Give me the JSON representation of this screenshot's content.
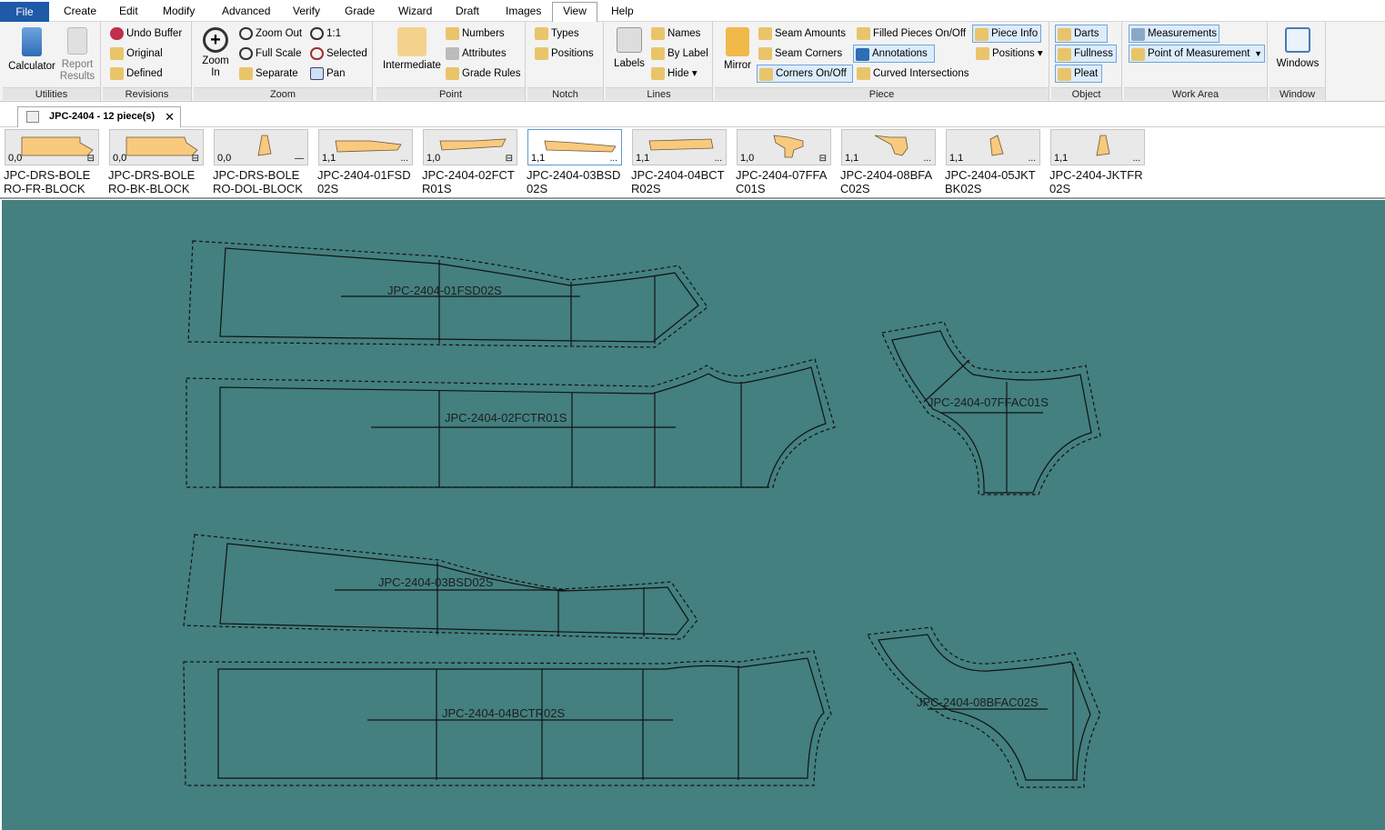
{
  "menu": {
    "file": "File",
    "items": [
      "Create",
      "Edit",
      "Modify",
      "Advanced",
      "Verify",
      "Grade",
      "Wizard",
      "Draft",
      "Images",
      "View",
      "Help"
    ]
  },
  "ribbon": {
    "utilities": {
      "label": "Utilities",
      "calculator": "Calculator",
      "report_results_line1": "Report",
      "report_results_line2": "Results"
    },
    "revisions": {
      "label": "Revisions",
      "undo_buffer": "Undo Buffer",
      "original": "Original",
      "defined": "Defined"
    },
    "zoom": {
      "label": "Zoom",
      "zoom_in_line1": "Zoom",
      "zoom_in_line2": "In",
      "zoom_out": "Zoom Out",
      "full_scale": "Full Scale",
      "separate": "Separate",
      "one_to_one": "1:1",
      "selected": "Selected",
      "pan": "Pan"
    },
    "point": {
      "label": "Point",
      "intermediate": "Intermediate",
      "numbers": "Numbers",
      "attributes": "Attributes",
      "grade_rules": "Grade Rules"
    },
    "notch": {
      "label": "Notch",
      "types": "Types",
      "positions": "Positions"
    },
    "lines": {
      "label": "Lines",
      "labels": "Labels",
      "names": "Names",
      "by_label": "By Label",
      "hide": "Hide ▾"
    },
    "piece": {
      "label": "Piece",
      "mirror": "Mirror",
      "seam_amounts": "Seam Amounts",
      "seam_corners": "Seam Corners",
      "corners_on_off": "Corners On/Off",
      "filled_pieces": "Filled Pieces On/Off",
      "annotations": "Annotations",
      "curved_intersections": "Curved Intersections",
      "piece_info": "Piece Info",
      "positions": "Positions ▾"
    },
    "object": {
      "label": "Object",
      "darts": "Darts",
      "fullness": "Fullness",
      "pleat": "Pleat"
    },
    "work_area": {
      "label": "Work Area",
      "measurements": "Measurements",
      "point_of_measurement": "Point of Measurement"
    },
    "window": {
      "label": "Window",
      "windows": "Windows"
    }
  },
  "doc_tab": {
    "title": "JPC-2404  -  12 piece(s)",
    "close": "✕"
  },
  "pieces": [
    {
      "line1": "JPC-DRS-BOLE",
      "line2": "RO-FR-BLOCK",
      "code": "0,0",
      "icon": "⊟"
    },
    {
      "line1": "JPC-DRS-BOLE",
      "line2": "RO-BK-BLOCK",
      "code": "0,0",
      "icon": "⊟"
    },
    {
      "line1": "JPC-DRS-BOLE",
      "line2": "RO-DOL-BLOCK",
      "code": "0,0",
      "icon": "—"
    },
    {
      "line1": "JPC-2404-01FSD",
      "line2": "02S",
      "code": "1,1",
      "icon": "..."
    },
    {
      "line1": "JPC-2404-02FCT",
      "line2": "R01S",
      "code": "1,0",
      "icon": "⊟"
    },
    {
      "line1": "JPC-2404-03BSD",
      "line2": "02S",
      "code": "1,1",
      "icon": "..."
    },
    {
      "line1": "JPC-2404-04BCT",
      "line2": "R02S",
      "code": "1,1",
      "icon": "..."
    },
    {
      "line1": "JPC-2404-07FFA",
      "line2": "C01S",
      "code": "1,0",
      "icon": "⊟"
    },
    {
      "line1": "JPC-2404-08BFA",
      "line2": "C02S",
      "code": "1,1",
      "icon": "..."
    },
    {
      "line1": "JPC-2404-05JKT",
      "line2": "BK02S",
      "code": "1,1",
      "icon": "..."
    },
    {
      "line1": "JPC-2404-JKTFR",
      "line2": "02S",
      "code": "1,1",
      "icon": "..."
    }
  ],
  "canvas_pieces": {
    "p01": "JPC-2404-01FSD02S",
    "p02": "JPC-2404-02FCTR01S",
    "p03": "JPC-2404-03BSD02S",
    "p04": "JPC-2404-04BCTR02S",
    "p07": "JPC-2404-07FFAC01S",
    "p08": "JPC-2404-08BFAC02S"
  },
  "colors": {
    "workarea": "#43807f",
    "piece_fill": "#f9c97e",
    "file_menu": "#1e5aa8"
  }
}
